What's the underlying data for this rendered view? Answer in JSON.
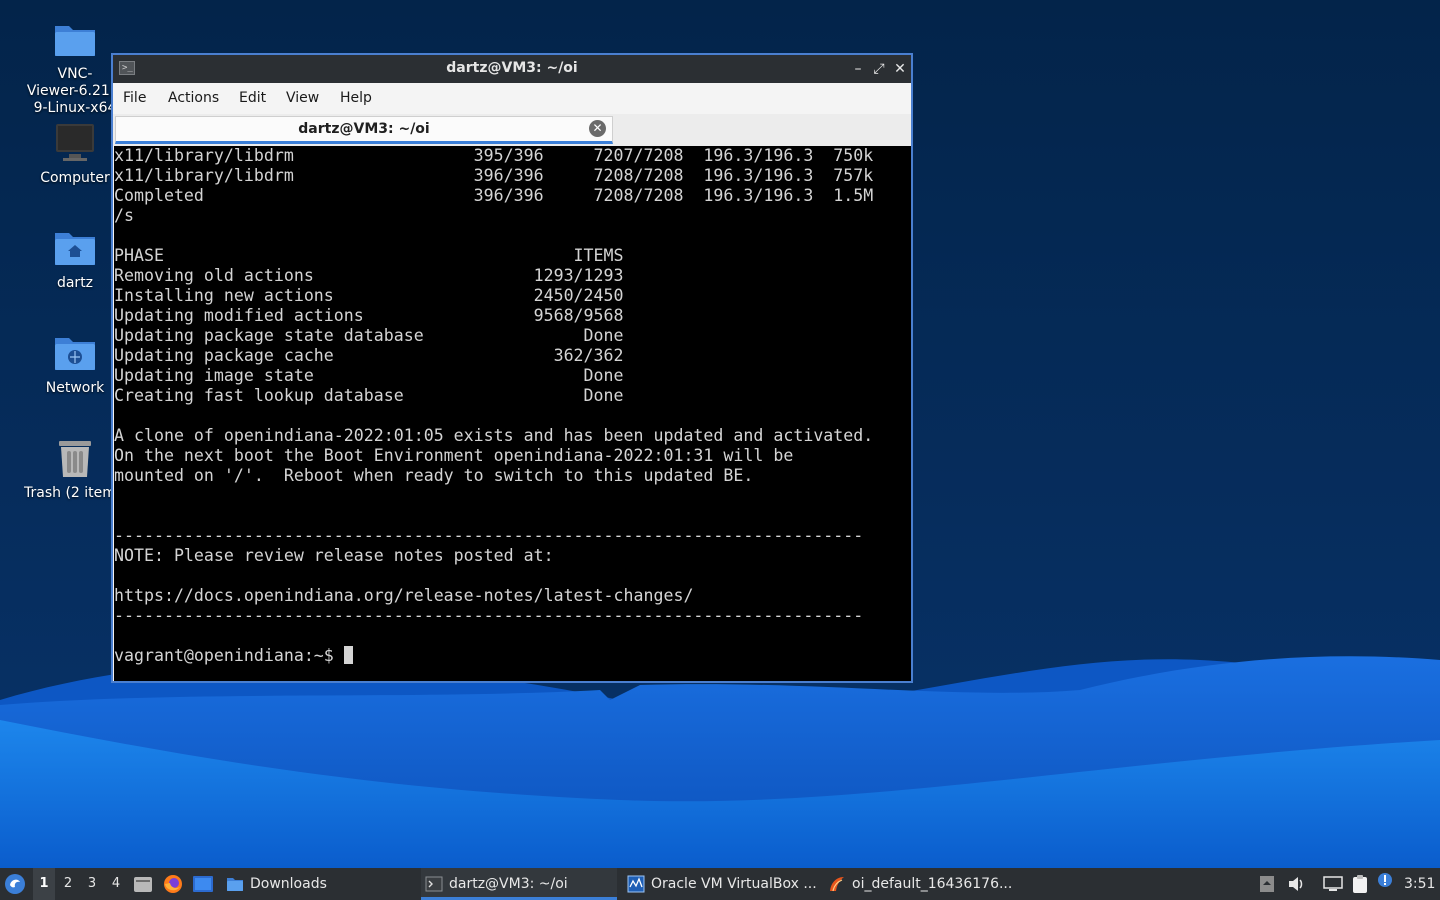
{
  "desktop": {
    "icons": [
      {
        "label": "VNC-\nViewer-6.21.1\n9-Linux-x64",
        "icon": "folder-icon"
      },
      {
        "label": "Computer",
        "icon": "computer-icon"
      },
      {
        "label": "dartz",
        "icon": "home-folder-icon"
      },
      {
        "label": "Network",
        "icon": "network-folder-icon"
      },
      {
        "label": "Trash (2 items)",
        "icon": "trash-icon"
      }
    ]
  },
  "window": {
    "title": "dartz@VM3: ~/oi",
    "app_icon_text": ">_",
    "controls": {
      "minimize": "–",
      "maximize": "⤢",
      "close": "✕"
    },
    "menu": [
      "File",
      "Actions",
      "Edit",
      "View",
      "Help"
    ],
    "tab": {
      "title": "dartz@VM3: ~/oi",
      "close": "✕"
    },
    "accent_color": "#4a7fd0"
  },
  "terminal": {
    "lines": [
      "x11/library/libdrm                  395/396     7207/7208  196.3/196.3  750k",
      "x11/library/libdrm                  396/396     7208/7208  196.3/196.3  757k",
      "Completed                           396/396     7208/7208  196.3/196.3  1.5M",
      "/s",
      "",
      "PHASE                                         ITEMS",
      "Removing old actions                      1293/1293",
      "Installing new actions                    2450/2450",
      "Updating modified actions                 9568/9568",
      "Updating package state database                Done",
      "Updating package cache                      362/362",
      "Updating image state                           Done",
      "Creating fast lookup database                  Done",
      "",
      "A clone of openindiana-2022:01:05 exists and has been updated and activated.",
      "On the next boot the Boot Environment openindiana-2022:01:31 will be",
      "mounted on '/'.  Reboot when ready to switch to this updated BE.",
      "",
      "",
      "---------------------------------------------------------------------------",
      "NOTE: Please review release notes posted at:",
      "",
      "https://docs.openindiana.org/release-notes/latest-changes/",
      "---------------------------------------------------------------------------",
      "",
      "vagrant@openindiana:~$ "
    ]
  },
  "taskbar": {
    "workspaces": [
      "1",
      "2",
      "3",
      "4"
    ],
    "active_workspace": "1",
    "tasks": [
      {
        "label": "Downloads",
        "icon": "folder-icon"
      },
      {
        "label": "dartz@VM3: ~/oi",
        "icon": "terminal-icon"
      },
      {
        "label": "Oracle VM VirtualBox ...",
        "icon": "virtualbox-icon"
      },
      {
        "label": "oi_default_16436176...",
        "icon": "image-viewer-icon"
      }
    ],
    "clock": "3:51"
  }
}
